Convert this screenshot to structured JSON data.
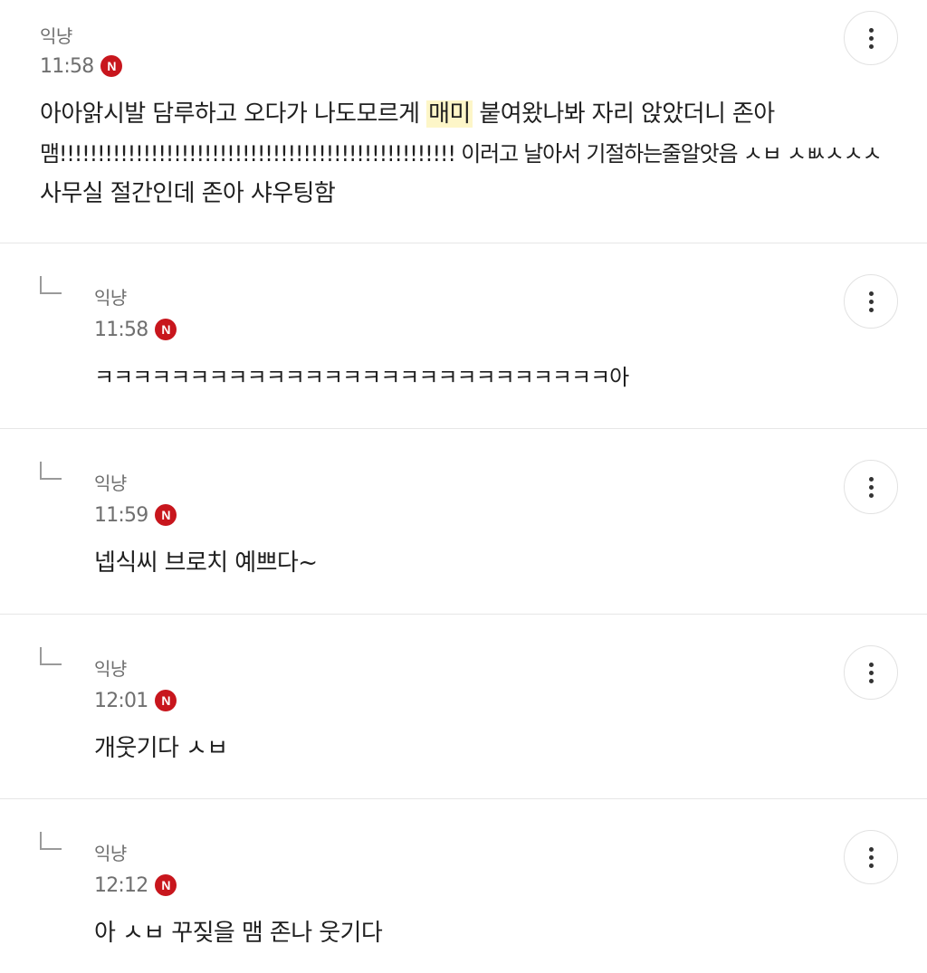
{
  "comments": [
    {
      "author": "익냥",
      "time": "11:58",
      "badge": "N",
      "line1_pre": "아아앍시발 담루하고 오다가 나도모르게 ",
      "line1_highlight": "매미",
      "line1_post": " 붙여왔나봐 자리 앉았더니 존아",
      "line2": "맴!!!!!!!!!!!!!!!!!!!!!!!!!!!!!!!!!!!!!!!!!!!!!!!!!!!! 이러고 날아서 기절하는줄알앗음 ㅅㅂ ㅅㅄㅅㅅㅅ",
      "line3": "사무실 절간인데 존아 샤우팅함"
    },
    {
      "author": "익냥",
      "time": "11:58",
      "badge": "N",
      "text": "ㅋㅋㅋㅋㅋㅋㅋㅋㅋㅋㅋㅋㅋㅋㅋㅋㅋㅋㅋㅋㅋㅋㅋㅋㅋㅋㅋ아"
    },
    {
      "author": "익냥",
      "time": "11:59",
      "badge": "N",
      "text": "넵식씨 브로치 예쁘다~"
    },
    {
      "author": "익냥",
      "time": "12:01",
      "badge": "N",
      "text": "개웃기다 ㅅㅂ"
    },
    {
      "author": "익냥",
      "time": "12:12",
      "badge": "N",
      "text": "아 ㅅㅂ 꾸짖을 맴 존나 웃기다"
    }
  ],
  "icons": {
    "more": "more-vertical-icon",
    "badge": "naver-n-badge"
  },
  "colors": {
    "badge": "#c8161d",
    "highlight": "#fdf6c8",
    "divider": "#e6e6e6"
  }
}
